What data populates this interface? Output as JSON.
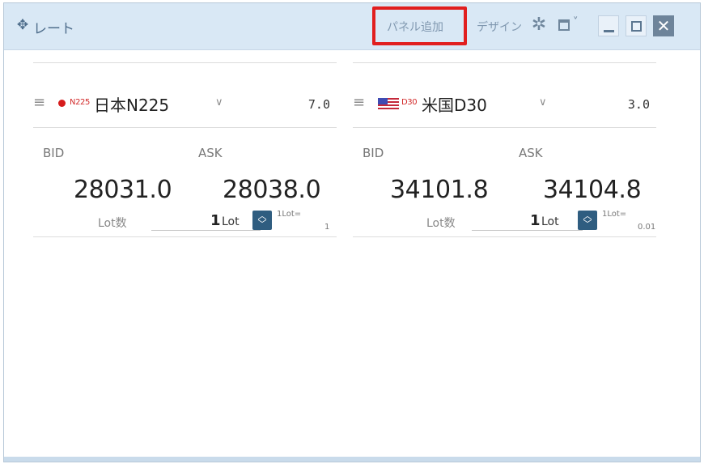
{
  "window": {
    "title": "レート",
    "toolbar": {
      "add_panel_label": "パネル追加",
      "design_label": "デザイン"
    },
    "icons": {
      "move": "move-icon",
      "settings": "gear-icon",
      "layout": "layout-icon",
      "minimize": "minimize-icon",
      "maximize": "maximize-icon",
      "close": "close-icon"
    },
    "highlight_color": "#e11e1e"
  },
  "panels": [
    {
      "flag": "japan",
      "symbol_code": "N225",
      "symbol_name": "日本N225",
      "spread": "7.0",
      "bid_label": "BID",
      "ask_label": "ASK",
      "bid": "28031.0",
      "ask": "28038.0",
      "lot_label": "Lot数",
      "lot_value": "1",
      "lot_unit": "Lot",
      "lot_ratio_label": "1Lot=",
      "lot_ratio_value": "1"
    },
    {
      "flag": "usa",
      "symbol_code": "D30",
      "symbol_name": "米国D30",
      "spread": "3.0",
      "bid_label": "BID",
      "ask_label": "ASK",
      "bid": "34101.8",
      "ask": "34104.8",
      "lot_label": "Lot数",
      "lot_value": "1",
      "lot_unit": "Lot",
      "lot_ratio_label": "1Lot=",
      "lot_ratio_value": "0.01"
    }
  ]
}
